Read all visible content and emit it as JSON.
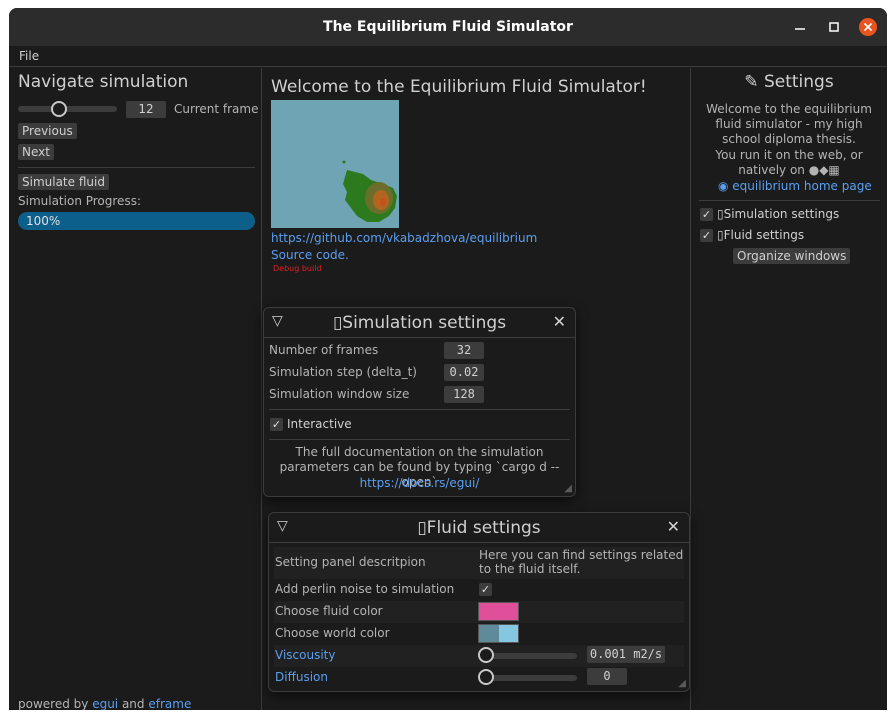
{
  "window": {
    "title": "The Equilibrium Fluid Simulator",
    "minimize_icon": "minimize-icon",
    "maximize_icon": "maximize-icon",
    "close_icon": "close-icon",
    "close_color": "#e95420"
  },
  "menu": {
    "file": "File"
  },
  "left": {
    "heading": "Navigate simulation",
    "frame_value": "12",
    "frame_slider_fraction": 0.4,
    "frame_label": "Current frame",
    "previous": "Previous",
    "next": "Next",
    "simulate": "Simulate fluid",
    "progress_label": "Simulation Progress:",
    "progress_text": "100%",
    "progress_fraction": 1.0,
    "progress_color": "#0b5f8a",
    "footer": {
      "prefix": "powered by ",
      "egui": "egui",
      "and": " and ",
      "eframe": "eframe"
    }
  },
  "center": {
    "welcome": "Welcome to the Equilibrium Fluid Simulator!",
    "github_link": "https://github.com/vkabadzhova/equilibrium",
    "source_code": "Source code.",
    "debug_build": "Debug build",
    "debug_color": "#e02020"
  },
  "right": {
    "heading": "Settings",
    "heading_icon": "pencil-icon",
    "intro": "Welcome to the equilibrium fluid simulator - my high school diploma thesis.",
    "web_line": "You run it on the web, or natively on",
    "os_icons": "apple-linux-windows-icons",
    "home_link": "equilibrium home page",
    "sim_settings": "Simulation settings",
    "fluid_settings": "Fluid settings",
    "organize": "Organize windows"
  },
  "sim_window": {
    "title": "Simulation settings",
    "rows": [
      {
        "label": "Number of frames",
        "value": "32"
      },
      {
        "label": "Simulation step (delta_t)",
        "value": "0.02"
      },
      {
        "label": "Simulation window size",
        "value": "128"
      }
    ],
    "interactive": "Interactive",
    "doc_text": "The full documentation on the simulation parameters can be found by typing `cargo d --open`",
    "doc_link": "https://docs.rs/egui/"
  },
  "fluid_window": {
    "title": "Fluid settings",
    "desc_label": "Setting panel descritpion",
    "desc_value": "Here you can find settings related to the fluid itself.",
    "perlin": "Add perlin noise to simulation",
    "fluid_color_label": "Choose fluid color",
    "fluid_color": "#e0509a",
    "world_color_label": "Choose world color",
    "world_color": "#86c6e0",
    "viscosity_label": "Viscousity",
    "viscosity_value": "0.001 m2/s",
    "viscosity_fraction": 0.0,
    "diffusion_label": "Diffusion",
    "diffusion_value": "0",
    "diffusion_fraction": 0.0
  }
}
